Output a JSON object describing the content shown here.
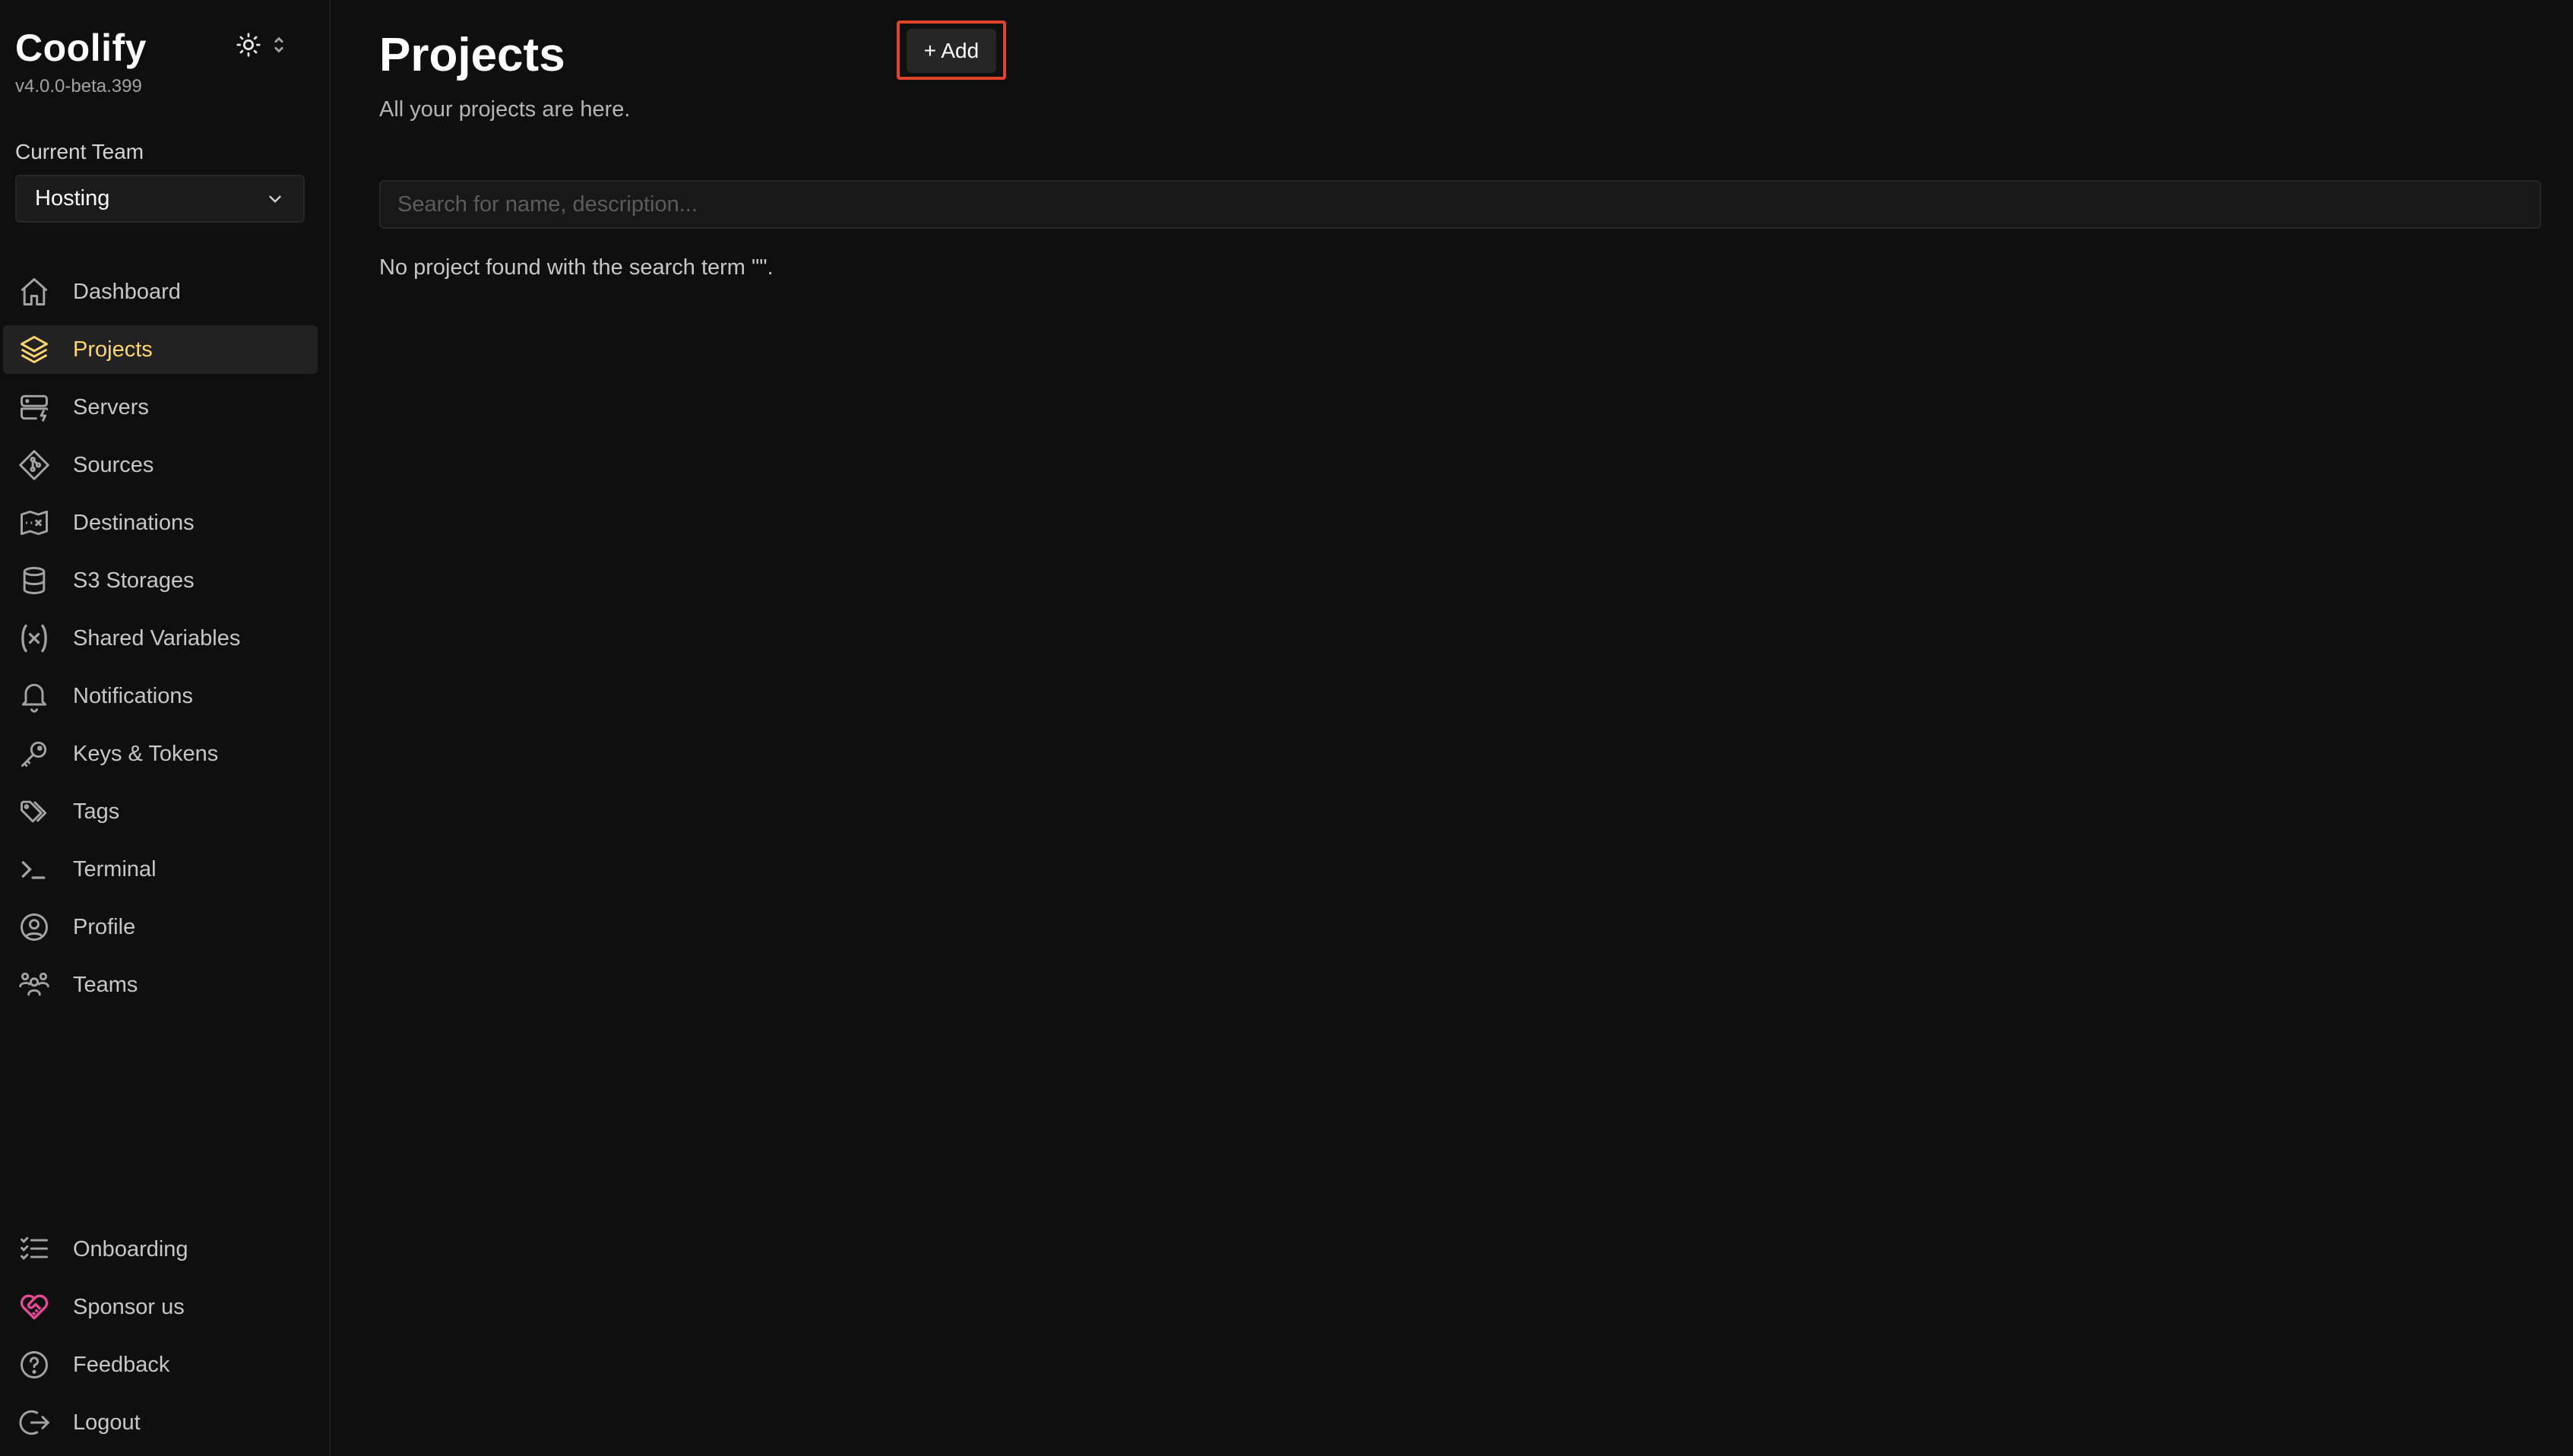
{
  "app": {
    "name": "Coolify",
    "version": "v4.0.0-beta.399"
  },
  "sidebar": {
    "team_label": "Current Team",
    "team_selected": "Hosting",
    "items": [
      {
        "label": "Dashboard",
        "icon": "home-icon"
      },
      {
        "label": "Projects",
        "icon": "layers-icon",
        "active": true
      },
      {
        "label": "Servers",
        "icon": "server-icon"
      },
      {
        "label": "Sources",
        "icon": "git-icon"
      },
      {
        "label": "Destinations",
        "icon": "map-icon"
      },
      {
        "label": "S3 Storages",
        "icon": "database-icon"
      },
      {
        "label": "Shared Variables",
        "icon": "variable-icon"
      },
      {
        "label": "Notifications",
        "icon": "bell-icon"
      },
      {
        "label": "Keys & Tokens",
        "icon": "key-icon"
      },
      {
        "label": "Tags",
        "icon": "tag-icon"
      },
      {
        "label": "Terminal",
        "icon": "terminal-icon"
      },
      {
        "label": "Profile",
        "icon": "user-circle-icon"
      },
      {
        "label": "Teams",
        "icon": "users-icon"
      }
    ],
    "bottom_items": [
      {
        "label": "Onboarding",
        "icon": "checklist-icon"
      },
      {
        "label": "Sponsor us",
        "icon": "heart-handshake-icon"
      },
      {
        "label": "Feedback",
        "icon": "help-circle-icon"
      },
      {
        "label": "Logout",
        "icon": "logout-icon"
      }
    ]
  },
  "main": {
    "title": "Projects",
    "add_label": "+ Add",
    "subtitle": "All your projects are here.",
    "search_placeholder": "Search for name, description...",
    "search_value": "",
    "empty_message": "No project found with the search term \"\"."
  },
  "colors": {
    "background": "#0f0f0f",
    "active_text": "#fcd56b",
    "highlight_border": "#e0452b",
    "sponsor_icon": "#ec4899"
  }
}
